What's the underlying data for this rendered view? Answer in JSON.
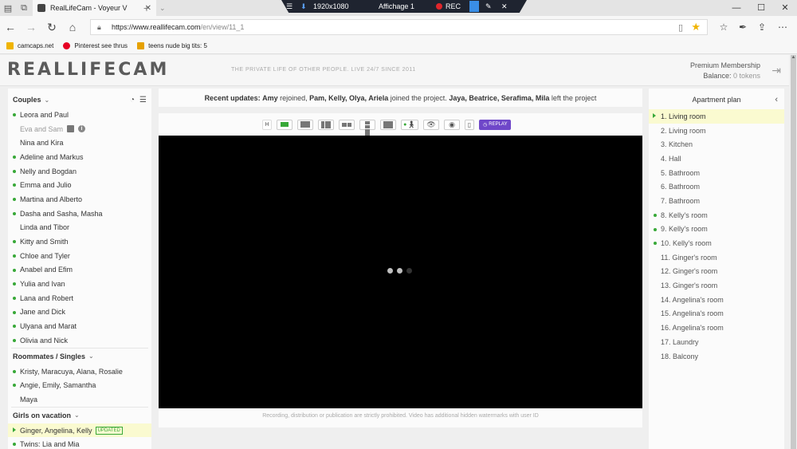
{
  "browser": {
    "tab_title": "RealLifeCam - Voyeur V",
    "tab_close": "✕",
    "url_host": "https://www.reallifecam.com",
    "url_path": "/en/view/11_1",
    "bookmarks": [
      {
        "label": "camcaps.net",
        "color": "#f0b400"
      },
      {
        "label": "Pinterest see thrus",
        "color": "#e60023"
      },
      {
        "label": "teens nude big tits: 5",
        "color": "#e6a100"
      }
    ]
  },
  "recorder": {
    "resolution": "1920x1080",
    "display": "Affichage 1",
    "rec_label": "REC"
  },
  "header": {
    "logo": "REALLIFECAM",
    "tagline": "THE PRIVATE LIFE OF OTHER PEOPLE. LIVE 24/7 SINCE 2011",
    "premium": "Premium Membership",
    "balance_label": "Balance:",
    "balance_value": "0 tokens"
  },
  "sidebar": {
    "couples_title": "Couples",
    "couples": [
      {
        "name": "Leora and Paul",
        "state": "live"
      },
      {
        "name": "Eva and Sam",
        "state": "dim"
      },
      {
        "name": "Nina and Kira",
        "state": "none"
      },
      {
        "name": "Adeline and Markus",
        "state": "live"
      },
      {
        "name": "Nelly and Bogdan",
        "state": "live"
      },
      {
        "name": "Emma and Julio",
        "state": "live"
      },
      {
        "name": "Martina and Alberto",
        "state": "live"
      },
      {
        "name": "Dasha and Sasha, Masha",
        "state": "live"
      },
      {
        "name": "Linda and Tibor",
        "state": "none"
      },
      {
        "name": "Kitty and Smith",
        "state": "live"
      },
      {
        "name": "Chloe and Tyler",
        "state": "live"
      },
      {
        "name": "Anabel and Efim",
        "state": "live"
      },
      {
        "name": "Yulia and Ivan",
        "state": "live"
      },
      {
        "name": "Lana and Robert",
        "state": "live"
      },
      {
        "name": "Jane and Dick",
        "state": "live"
      },
      {
        "name": "Ulyana and Marat",
        "state": "live"
      },
      {
        "name": "Olivia and Nick",
        "state": "live"
      }
    ],
    "roommates_title": "Roommates / Singles",
    "roommates": [
      {
        "name": "Kristy, Maracuya, Alana, Rosalie",
        "state": "live"
      },
      {
        "name": "Angie, Emily, Samantha",
        "state": "live"
      },
      {
        "name": "Maya",
        "state": "none"
      }
    ],
    "vacation_title": "Girls on vacation",
    "vacation": [
      {
        "name": "Ginger, Angelina, Kelly",
        "state": "selected",
        "badge": "UPDATED"
      },
      {
        "name": "Twins: Lia and Mia",
        "state": "live"
      }
    ]
  },
  "updates": {
    "label": "Recent updates:",
    "name1": "Amy",
    "text1": "rejoined,",
    "names2": "Pam, Kelly, Olya, Ariela",
    "text2": "joined the project.",
    "names3": "Jaya, Beatrice, Serafima, Mila",
    "text3": "left the project"
  },
  "player": {
    "h_label": "H",
    "replay_label": "REPLAY",
    "notice": "Recording, distribution or publication are strictly prohibited. Video has additional hidden watermarks with user ID"
  },
  "apartment": {
    "title": "Apartment plan",
    "rooms": [
      {
        "name": "1. Living room",
        "state": "active"
      },
      {
        "name": "2. Living room",
        "state": "none"
      },
      {
        "name": "3. Kitchen",
        "state": "none"
      },
      {
        "name": "4. Hall",
        "state": "none"
      },
      {
        "name": "5. Bathroom",
        "state": "none"
      },
      {
        "name": "6. Bathroom",
        "state": "none"
      },
      {
        "name": "7. Bathroom",
        "state": "none"
      },
      {
        "name": "8. Kelly's room",
        "state": "live"
      },
      {
        "name": "9. Kelly's room",
        "state": "live"
      },
      {
        "name": "10. Kelly's room",
        "state": "live"
      },
      {
        "name": "11. Ginger's room",
        "state": "none"
      },
      {
        "name": "12. Ginger's room",
        "state": "none"
      },
      {
        "name": "13. Ginger's room",
        "state": "none"
      },
      {
        "name": "14. Angelina's room",
        "state": "none"
      },
      {
        "name": "15. Angelina's room",
        "state": "none"
      },
      {
        "name": "16. Angelina's room",
        "state": "none"
      },
      {
        "name": "17. Laundry",
        "state": "none"
      },
      {
        "name": "18. Balcony",
        "state": "none"
      }
    ]
  }
}
